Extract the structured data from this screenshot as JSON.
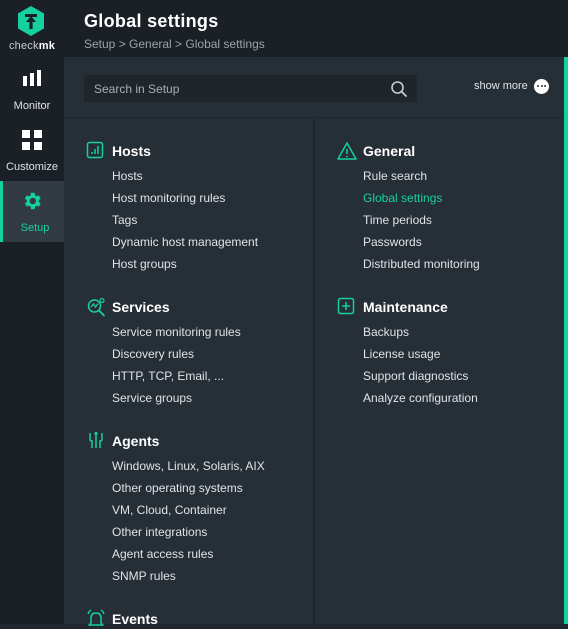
{
  "app": {
    "logo_text_a": "check",
    "logo_text_b": "mk"
  },
  "sidebar": {
    "items": [
      {
        "label": "Monitor",
        "icon": "bar-chart-icon"
      },
      {
        "label": "Customize",
        "icon": "grid-icon"
      },
      {
        "label": "Setup",
        "icon": "gear-icon",
        "active": true
      }
    ]
  },
  "header": {
    "title": "Global settings",
    "breadcrumb": "Setup > General > Global settings"
  },
  "toolbar": {
    "search_placeholder": "Search in Setup",
    "show_more_label": "show more"
  },
  "colors": {
    "accent": "#15d1a0",
    "background": "#262e36",
    "sidebar": "#1b2026"
  },
  "sections": {
    "hosts": {
      "title": "Hosts",
      "icon": "hosts-icon",
      "items": [
        "Hosts",
        "Host monitoring rules",
        "Tags",
        "Dynamic host management",
        "Host groups"
      ]
    },
    "services": {
      "title": "Services",
      "icon": "services-icon",
      "items": [
        "Service monitoring rules",
        "Discovery rules",
        "HTTP, TCP, Email, ...",
        "Service groups"
      ]
    },
    "agents": {
      "title": "Agents",
      "icon": "agents-icon",
      "items": [
        "Windows, Linux, Solaris, AIX",
        "Other operating systems",
        "VM, Cloud, Container",
        "Other integrations",
        "Agent access rules",
        "SNMP rules"
      ]
    },
    "events": {
      "title": "Events",
      "icon": "bell-icon"
    },
    "general": {
      "title": "General",
      "icon": "warning-triangle-icon",
      "items": [
        "Rule search",
        "Global settings",
        "Time periods",
        "Passwords",
        "Distributed monitoring"
      ],
      "active_item": "Global settings"
    },
    "maintenance": {
      "title": "Maintenance",
      "icon": "plus-box-icon",
      "items": [
        "Backups",
        "License usage",
        "Support diagnostics",
        "Analyze configuration"
      ]
    }
  }
}
